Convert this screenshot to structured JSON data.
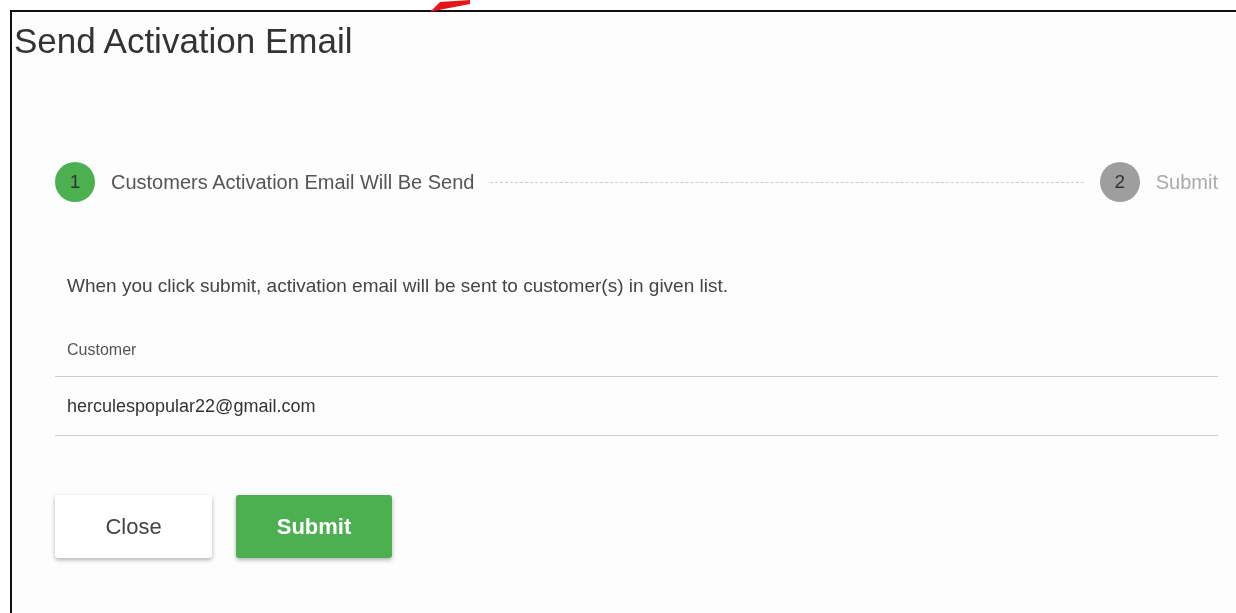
{
  "dialog": {
    "title": "Send Activation Email"
  },
  "steps": [
    {
      "number": "1",
      "label": "Customers Activation Email Will Be Send",
      "active": true
    },
    {
      "number": "2",
      "label": "Submit",
      "active": false
    }
  ],
  "message": "When you click submit, activation email will be sent to customer(s) in given list.",
  "customer_field": {
    "label": "Customer",
    "value": "herculespopular22@gmail.com"
  },
  "buttons": [
    {
      "label": "Close",
      "kind": "secondary"
    },
    {
      "label": "Submit",
      "kind": "primary"
    }
  ]
}
